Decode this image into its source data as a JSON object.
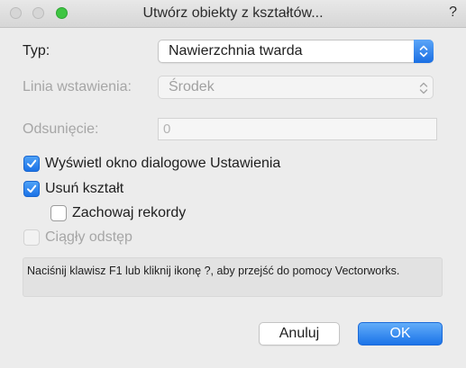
{
  "window": {
    "title": "Utwórz obiekty z kształtów...",
    "help_mark": "?"
  },
  "form": {
    "type_label": "Typ:",
    "type_value": "Nawierzchnia twarda",
    "insertion_label": "Linia wstawienia:",
    "insertion_value": "Środek",
    "offset_label": "Odsunięcie:",
    "offset_value": "0"
  },
  "options": {
    "show_settings": {
      "label": "Wyświetl okno dialogowe Ustawienia",
      "checked": true
    },
    "delete_shape": {
      "label": "Usuń kształt",
      "checked": true
    },
    "keep_records": {
      "label": "Zachowaj rekordy",
      "checked": false
    },
    "continuous_spacing": {
      "label": "Ciągły odstęp",
      "checked": false,
      "enabled": false
    }
  },
  "help_text": "Naciśnij klawisz F1 lub kliknij ikonę ?, aby przejść do pomocy Vectorworks.",
  "buttons": {
    "cancel": "Anuluj",
    "ok": "OK"
  },
  "colors": {
    "accent": "#1b73e8",
    "close_button": "#d6d6d6",
    "zoom_button": "#3ec542"
  }
}
